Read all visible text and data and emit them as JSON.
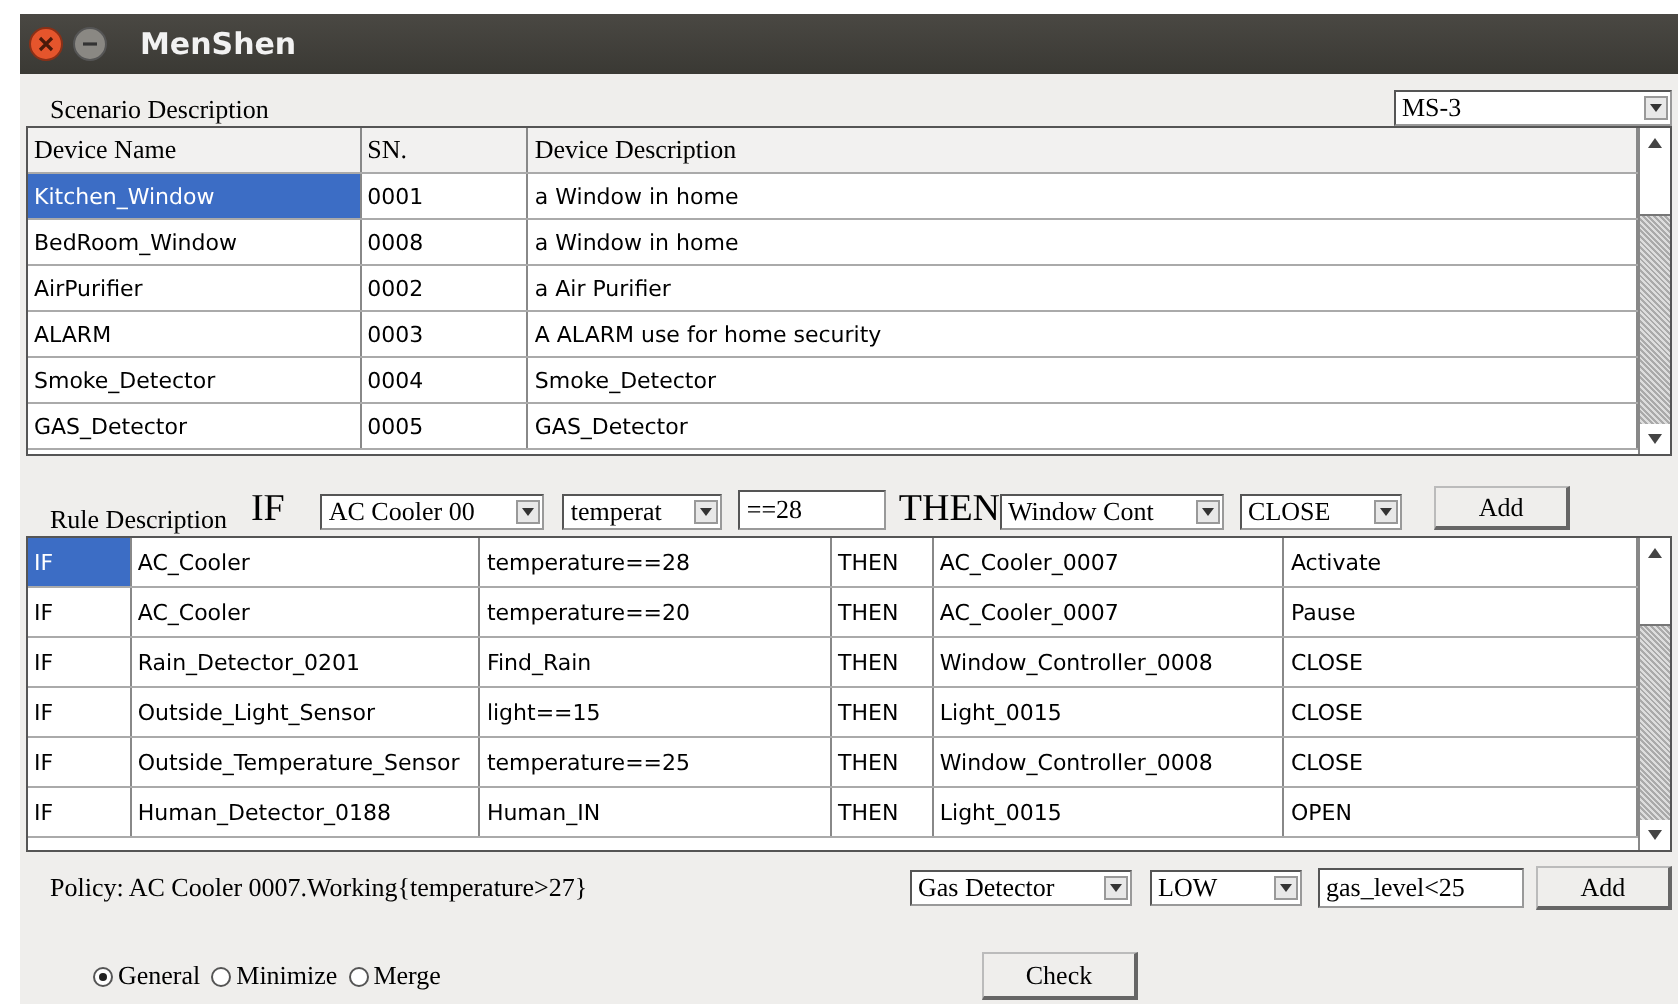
{
  "window": {
    "title": "MenShen"
  },
  "scenario": {
    "label": "Scenario Description",
    "selector": {
      "value": "MS-3"
    },
    "table": {
      "columns": [
        "Device Name",
        "SN.",
        "Device Description"
      ],
      "rows": [
        {
          "cells": [
            "Kitchen_Window",
            "0001",
            "a Window in home"
          ],
          "selected": true
        },
        {
          "cells": [
            "BedRoom_Window",
            "0008",
            "a Window in home"
          ],
          "selected": false
        },
        {
          "cells": [
            "AirPurifier",
            "0002",
            "a Air Purifier"
          ],
          "selected": false
        },
        {
          "cells": [
            "ALARM",
            "0003",
            "A ALARM use for home security"
          ],
          "selected": false
        },
        {
          "cells": [
            "Smoke_Detector",
            "0004",
            "Smoke_Detector"
          ],
          "selected": false
        },
        {
          "cells": [
            "GAS_Detector",
            "0005",
            "GAS_Detector"
          ],
          "selected": false
        }
      ]
    }
  },
  "rule": {
    "label": "Rule Description",
    "if_label": "IF",
    "device": "AC Cooler 00",
    "attribute": "temperat",
    "condition": "==28",
    "then_label": "THEN",
    "target": "Window Cont",
    "action": "CLOSE",
    "add": "Add",
    "table": {
      "rows": [
        {
          "cells": [
            "IF",
            "AC_Cooler",
            "temperature==28",
            "THEN",
            "AC_Cooler_0007",
            "Activate"
          ],
          "selected": true
        },
        {
          "cells": [
            "IF",
            "AC_Cooler",
            "temperature==20",
            "THEN",
            "AC_Cooler_0007",
            "Pause"
          ],
          "selected": false
        },
        {
          "cells": [
            "IF",
            "Rain_Detector_0201",
            "Find_Rain",
            "THEN",
            "Window_Controller_0008",
            "CLOSE"
          ],
          "selected": false
        },
        {
          "cells": [
            "IF",
            "Outside_Light_Sensor",
            "light==15",
            "THEN",
            "Light_0015",
            "CLOSE"
          ],
          "selected": false
        },
        {
          "cells": [
            "IF",
            "Outside_Temperature_Sensor",
            "temperature==25",
            "THEN",
            "Window_Controller_0008",
            "CLOSE"
          ],
          "selected": false
        },
        {
          "cells": [
            "IF",
            "Human_Detector_0188",
            "Human_IN",
            "THEN",
            "Light_0015",
            "OPEN"
          ],
          "selected": false
        }
      ]
    }
  },
  "policy": {
    "text": "Policy: AC Cooler 0007.Working{temperature>27}",
    "device": "Gas Detector",
    "level": "LOW",
    "condition": "gas_level<25",
    "add": "Add"
  },
  "modes": [
    {
      "label": "General",
      "selected": true
    },
    {
      "label": "Minimize",
      "selected": false
    },
    {
      "label": "Merge",
      "selected": false
    }
  ],
  "check": "Check"
}
